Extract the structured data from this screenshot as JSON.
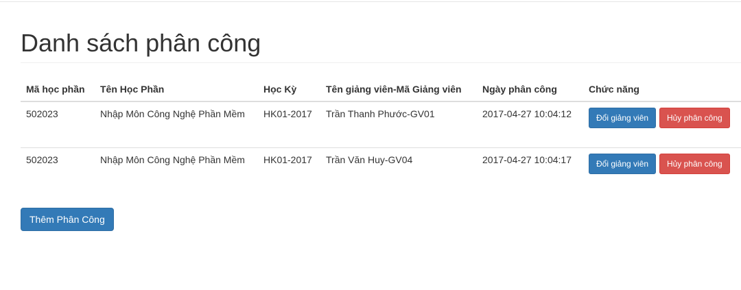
{
  "page": {
    "title": "Danh sách phân công",
    "add_button_label": "Thêm Phân Công"
  },
  "table": {
    "headers": [
      "Mã học phần",
      "Tên Học Phần",
      "Học Kỳ",
      "Tên giảng viên-Mã Giảng viên",
      "Ngày phân công",
      "Chức năng"
    ],
    "rows": [
      {
        "ma_hoc_phan": "502023",
        "ten_hoc_phan": "Nhập Môn Công Nghệ Phần Mềm",
        "hoc_ky": "HK01-2017",
        "giang_vien": "Trần Thanh Phước-GV01",
        "ngay_phan_cong": "2017-04-27 10:04:12",
        "change_label": "Đổi giảng viên",
        "cancel_label": "Hủy phân công"
      },
      {
        "ma_hoc_phan": "502023",
        "ten_hoc_phan": "Nhập Môn Công Nghệ Phần Mềm",
        "hoc_ky": "HK01-2017",
        "giang_vien": "Trần Văn Huy-GV04",
        "ngay_phan_cong": "2017-04-27 10:04:17",
        "change_label": "Đổi giảng viên",
        "cancel_label": "Hủy phân công"
      }
    ]
  },
  "colors": {
    "primary": "#337ab7",
    "danger": "#d9534f"
  }
}
